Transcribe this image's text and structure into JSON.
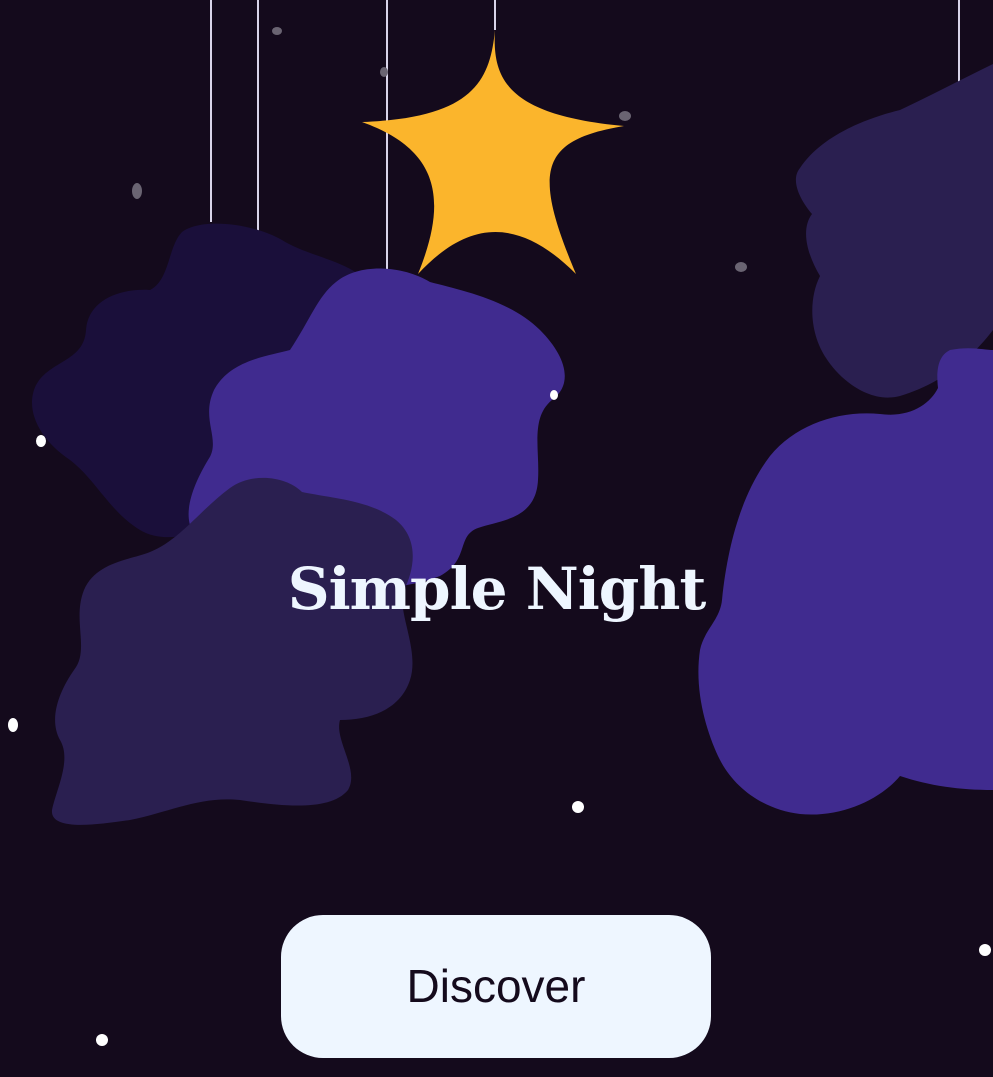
{
  "hero": {
    "title": "Simple Night"
  },
  "actions": {
    "discover_label": "Discover"
  },
  "colors": {
    "background": "#140a1c",
    "cloud_dark": "#1a0f3a",
    "cloud_mid": "#2a1f50",
    "cloud_bright": "#402b8f",
    "star": "#fbb52c",
    "string": "#d9d4ea",
    "text": "#eef6ff"
  },
  "icons": {
    "star": "star-icon",
    "clouds": "cloud-icon"
  }
}
